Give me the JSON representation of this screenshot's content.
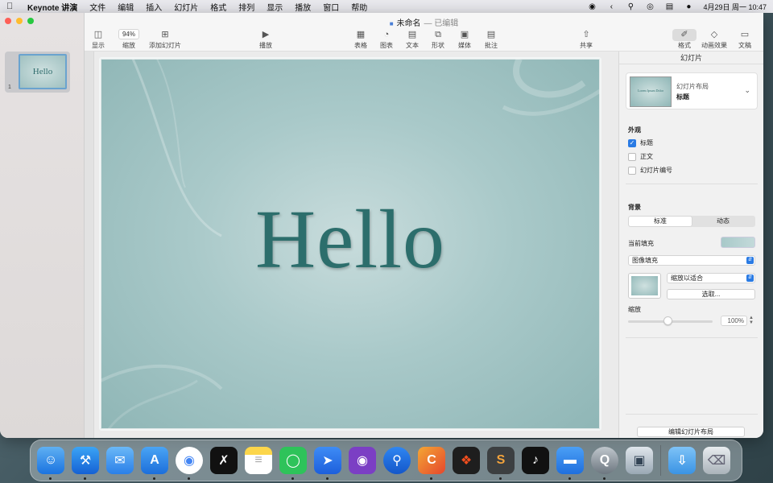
{
  "menubar": {
    "items": [
      "Keynote 讲演",
      "文件",
      "编辑",
      "插入",
      "幻灯片",
      "格式",
      "排列",
      "显示",
      "播放",
      "窗口",
      "帮助"
    ],
    "clock": "4月29日 周一  10:47"
  },
  "window": {
    "doc_title": "未命名",
    "doc_status": "— 已编辑",
    "zoom_value": "94%"
  },
  "toolbar": {
    "view": "显示",
    "zoom": "缩放",
    "add_slide": "添加幻灯片",
    "play": "播放",
    "table": "表格",
    "chart": "图表",
    "text": "文本",
    "shape": "形状",
    "media": "媒体",
    "comment": "批注",
    "share": "共享",
    "format": "格式",
    "animate": "动画效果",
    "document": "文稿"
  },
  "sidebar": {
    "slides": [
      {
        "number": "1",
        "title": "Hello"
      }
    ]
  },
  "slide": {
    "title_text": "Hello"
  },
  "inspector": {
    "title": "幻灯片",
    "layout_label": "幻灯片布局",
    "layout_name": "标题",
    "layout_thumb_text": "Lorem Ipsum Dolor",
    "appearance": "外观",
    "checkbox_title": "标题",
    "checkbox_body": "正文",
    "checkbox_slide_number": "幻灯片编号",
    "background": "背景",
    "seg_standard": "标准",
    "seg_dynamic": "动态",
    "current_fill": "当前填充",
    "fill_type": "图像填充",
    "scale_mode": "缩放以适合",
    "choose_button": "选取...",
    "scale_label": "缩放",
    "scale_value": "100%",
    "edit_layout_button": "编辑幻灯片布局"
  },
  "dock": {
    "apps": [
      "Finder",
      "Xcode",
      "Mail",
      "Simulator",
      "Chrome",
      "CapCut",
      "Notes",
      "WeChat",
      "Feishu",
      "GitHub Desktop",
      "Pin",
      "Clion",
      "Figma",
      "Sublime Text",
      "TikTok",
      "Keynote",
      "QuickTime Player",
      "Preview",
      "Downloads",
      "Trash"
    ]
  }
}
